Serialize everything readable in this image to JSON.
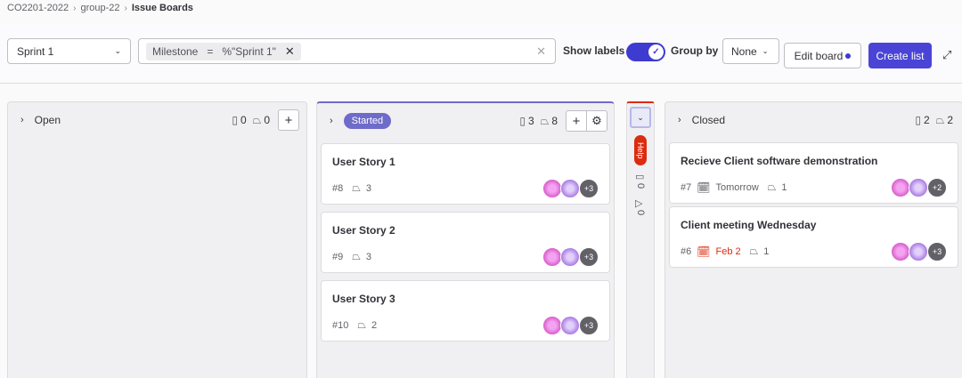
{
  "breadcrumb": [
    "CO2201-2022",
    "group-22",
    "Issue Boards"
  ],
  "filters": {
    "sprint_value": "Sprint 1",
    "token_key": "Milestone",
    "token_op": "=",
    "token_value": "%\"Sprint 1\"",
    "show_labels": "Show labels",
    "show_labels_on": true,
    "group_by": "Group by",
    "group_by_value": "None",
    "edit_board": "Edit board",
    "create_list": "Create list"
  },
  "lists": {
    "open": {
      "title": "Open",
      "issue_count": "0",
      "weight": "0"
    },
    "started": {
      "title": "Started",
      "issue_count": "3",
      "weight": "8"
    },
    "help": {
      "title": "Help",
      "issue_count": "0",
      "weight": "0"
    },
    "closed": {
      "title": "Closed",
      "issue_count": "2",
      "weight": "2"
    }
  },
  "started_cards": [
    {
      "title": "User Story 1",
      "id": "#8",
      "weight": "3",
      "more": "+3"
    },
    {
      "title": "User Story 2",
      "id": "#9",
      "weight": "3",
      "more": "+3"
    },
    {
      "title": "User Story 3",
      "id": "#10",
      "weight": "2",
      "more": "+3"
    }
  ],
  "closed_cards": [
    {
      "title": "Recieve Client software demonstration",
      "id": "#7",
      "due": "Tomorrow",
      "weight": "1",
      "more": "+2"
    },
    {
      "title": "Client meeting Wednesday",
      "id": "#6",
      "due": "Feb 2",
      "weight": "1",
      "more": "+3",
      "due_color": "#dd2b0e"
    }
  ],
  "icons": {
    "breadcrumb_sep": "chevron-right-icon",
    "issues": "issues-icon",
    "weight": "weight-icon",
    "calendar": "calendar-icon"
  },
  "colors": {
    "primary": "#4a44d6",
    "started_label": "#6f6bca",
    "help_label": "#dd2b0e",
    "overdue": "#dd2b0e"
  }
}
